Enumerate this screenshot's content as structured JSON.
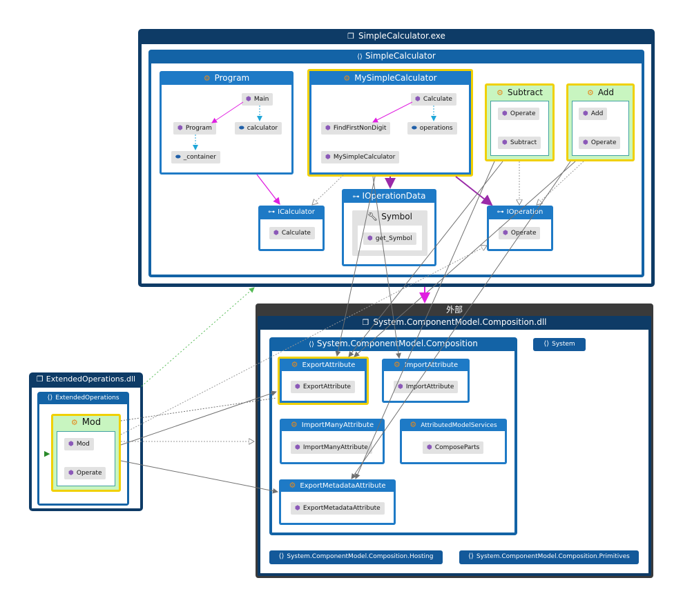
{
  "assemblies": {
    "simple_calculator": {
      "title": "SimpleCalculator.exe",
      "namespace": "SimpleCalculator"
    },
    "extended_operations": {
      "title": "ExtendedOperations.dll",
      "namespace": "ExtendedOperations"
    },
    "external": {
      "title": "外部"
    },
    "composition_dll": {
      "title": "System.ComponentModel.Composition.dll"
    }
  },
  "classes": {
    "program": {
      "title": "Program",
      "members": [
        "Main",
        "Program",
        "calculator",
        "_container"
      ]
    },
    "my_simple_calculator": {
      "title": "MySimpleCalculator",
      "members": [
        "Calculate",
        "FindFirstNonDigit",
        "operations",
        "MySimpleCalculator"
      ]
    },
    "subtract": {
      "title": "Subtract",
      "members": [
        "Operate",
        "Subtract"
      ]
    },
    "add": {
      "title": "Add",
      "members": [
        "Add",
        "Operate"
      ]
    },
    "icalculator": {
      "title": "ICalculator",
      "members": [
        "Calculate"
      ]
    },
    "ioperation_data": {
      "title": "IOperationData",
      "inner_title": "Symbol",
      "members": [
        "get_Symbol"
      ]
    },
    "ioperation": {
      "title": "IOperation",
      "members": [
        "Operate"
      ]
    },
    "mod": {
      "title": "Mod",
      "members": [
        "Mod",
        "Operate"
      ]
    }
  },
  "composition": {
    "namespace": "System.ComponentModel.Composition",
    "export_attribute": {
      "title": "ExportAttribute",
      "member": "ExportAttribute"
    },
    "import_attribute": {
      "title": "ImportAttribute",
      "member": "ImportAttribute"
    },
    "import_many_attribute": {
      "title": "ImportManyAttribute",
      "member": "ImportManyAttribute"
    },
    "attributed_model_services": {
      "title": "AttributedModelServices",
      "member": "ComposeParts"
    },
    "export_metadata_attribute": {
      "title": "ExportMetadataAttribute",
      "member": "ExportMetadataAttribute"
    },
    "system_ns": "System",
    "hosting_ns": "System.ComponentModel.Composition.Hosting",
    "primitives_ns": "System.ComponentModel.Composition.Primitives"
  },
  "colors": {
    "assembly": "#0e3b66",
    "namespace": "#1363a6",
    "class": "#1e7ac6",
    "highlight": "#f0d000",
    "green_header": "#c8f5c0",
    "call_edge": "#e020e0",
    "field_edge": "#1fa6d8",
    "gray_edge": "#707070",
    "inherit_edge": "#9a2aa8",
    "external_group": "#3a3a3a"
  }
}
